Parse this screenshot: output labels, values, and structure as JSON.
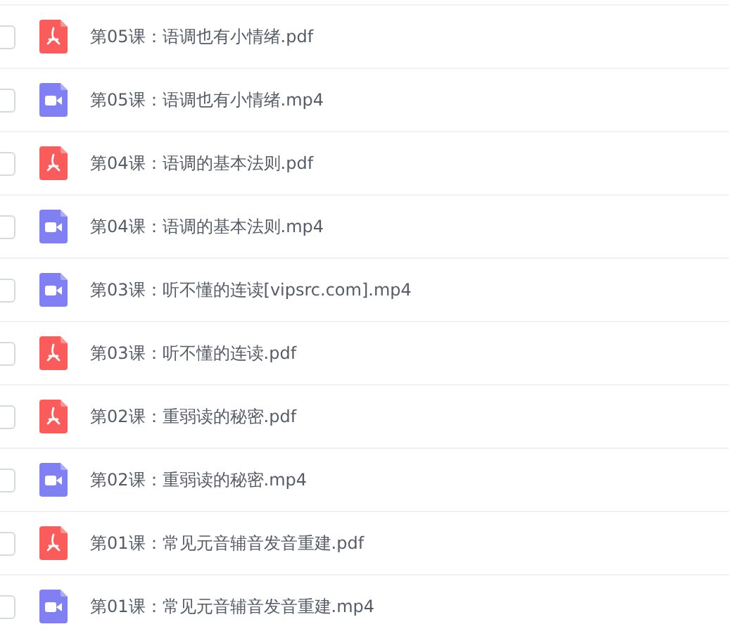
{
  "files": [
    {
      "kind": "pdf",
      "name": "第05课：语调也有小情绪.pdf",
      "checked": false
    },
    {
      "kind": "video",
      "name": "第05课：语调也有小情绪.mp4",
      "checked": false
    },
    {
      "kind": "pdf",
      "name": "第04课：语调的基本法则.pdf",
      "checked": false
    },
    {
      "kind": "video",
      "name": "第04课：语调的基本法则.mp4",
      "checked": false
    },
    {
      "kind": "video",
      "name": "第03课：听不懂的连读[vipsrc.com].mp4",
      "checked": false
    },
    {
      "kind": "pdf",
      "name": "第03课：听不懂的连读.pdf",
      "checked": false
    },
    {
      "kind": "pdf",
      "name": "第02课：重弱读的秘密.pdf",
      "checked": false
    },
    {
      "kind": "video",
      "name": "第02课：重弱读的秘密.mp4",
      "checked": false
    },
    {
      "kind": "pdf",
      "name": "第01课：常见元音辅音发音重建.pdf",
      "checked": false
    },
    {
      "kind": "video",
      "name": "第01课：常见元音辅音发音重建.mp4",
      "checked": false
    }
  ]
}
